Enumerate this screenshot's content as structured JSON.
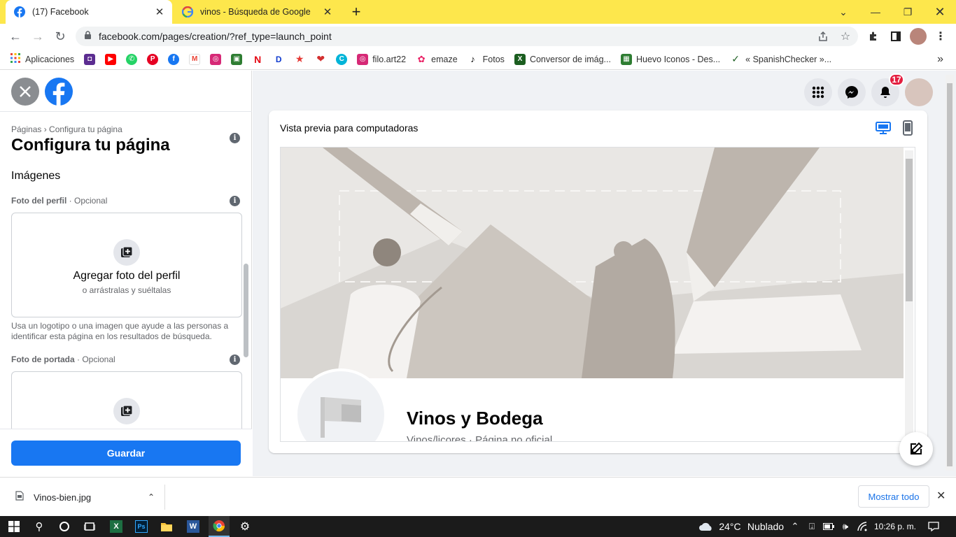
{
  "browser": {
    "tabs": [
      {
        "title": "(17) Facebook",
        "active": true,
        "favicon": "facebook-icon"
      },
      {
        "title": "vinos - Búsqueda de Google",
        "active": false,
        "favicon": "google-icon"
      }
    ],
    "new_tab": "+",
    "url": "facebook.com/pages/creation/?ref_type=launch_point"
  },
  "bookmarks": {
    "apps_label": "Aplicaciones",
    "items": [
      {
        "label": "filo.art22",
        "icon": "instagram-icon"
      },
      {
        "label": "emaze",
        "icon": "emaze-icon"
      },
      {
        "label": "Fotos",
        "icon": "tiktok-icon"
      },
      {
        "label": "Conversor de imág...",
        "icon": "converter-icon"
      },
      {
        "label": "Huevo Iconos - Des...",
        "icon": "huevo-icon"
      },
      {
        "label": "« SpanishChecker »...",
        "icon": "checker-icon"
      }
    ],
    "more": "»"
  },
  "left_panel": {
    "breadcrumb": "Páginas › Configura tu página",
    "title": "Configura tu página",
    "section_images": "Imágenes",
    "profile_label": "Foto del perfil",
    "profile_optional": " · Opcional",
    "add_profile": "Agregar foto del perfil",
    "drag_hint": "o arrástralas y suéltalas",
    "profile_help": "Usa un logotipo o una imagen que ayude a las personas a identificar esta página en los resultados de búsqueda.",
    "cover_label": "Foto de portada",
    "cover_optional": " · Opcional",
    "save": "Guardar"
  },
  "header": {
    "notifications_badge": "17"
  },
  "preview": {
    "title": "Vista previa para computadoras",
    "page_name": "Vinos y Bodega",
    "page_sub": "Vinos/licores · Página no oficial"
  },
  "downloads": {
    "file": "Vinos-bien.jpg",
    "show_all": "Mostrar todo"
  },
  "taskbar": {
    "weather_temp": "24°C",
    "weather_desc": "Nublado",
    "time": "10:26 p. m."
  },
  "colors": {
    "chrome_frame": "#fde74c",
    "facebook_blue": "#1877f2",
    "badge_red": "#e41e3f"
  }
}
